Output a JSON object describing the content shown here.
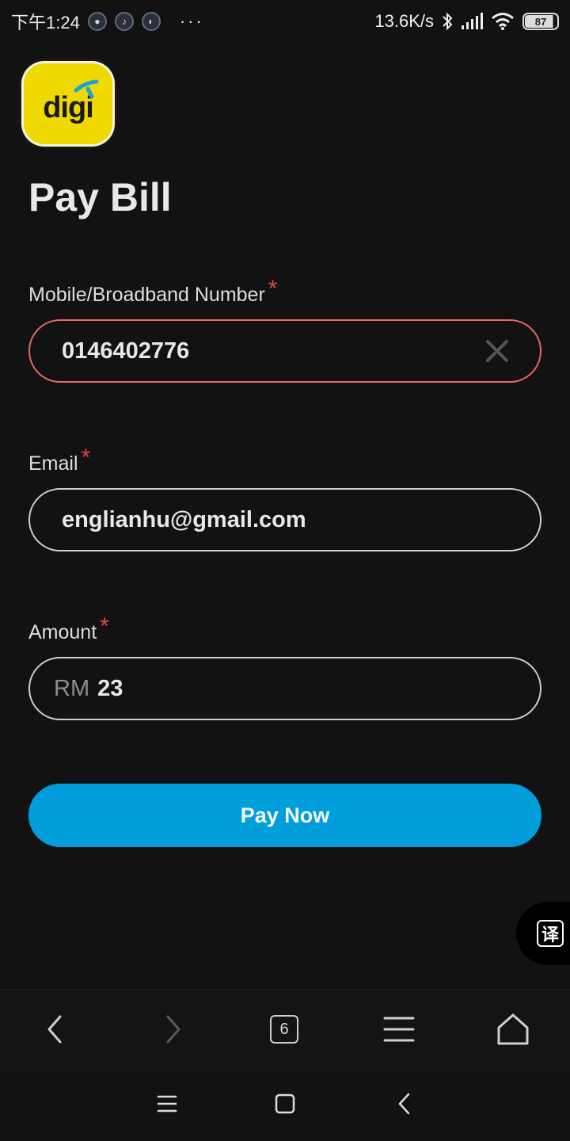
{
  "status_bar": {
    "time": "下午1:24",
    "more": "···",
    "net_speed": "13.6K/s",
    "battery": "87"
  },
  "logo": {
    "text": "digi"
  },
  "page_title": "Pay Bill",
  "form": {
    "mobile": {
      "label": "Mobile/Broadband Number",
      "required": "*",
      "value": "0146402776"
    },
    "email": {
      "label": "Email",
      "required": "*",
      "value": "englianhu@gmail.com"
    },
    "amount": {
      "label": "Amount",
      "required": "*",
      "currency": "RM",
      "value": "23"
    }
  },
  "pay_button": {
    "label": "Pay Now"
  },
  "translate_fab": {
    "glyph": "译"
  },
  "browser_bar": {
    "tab_count": "6"
  },
  "colors": {
    "accent": "#009fdb",
    "error": "#e76a62",
    "background": "#121212",
    "logo": "#f0d900"
  }
}
